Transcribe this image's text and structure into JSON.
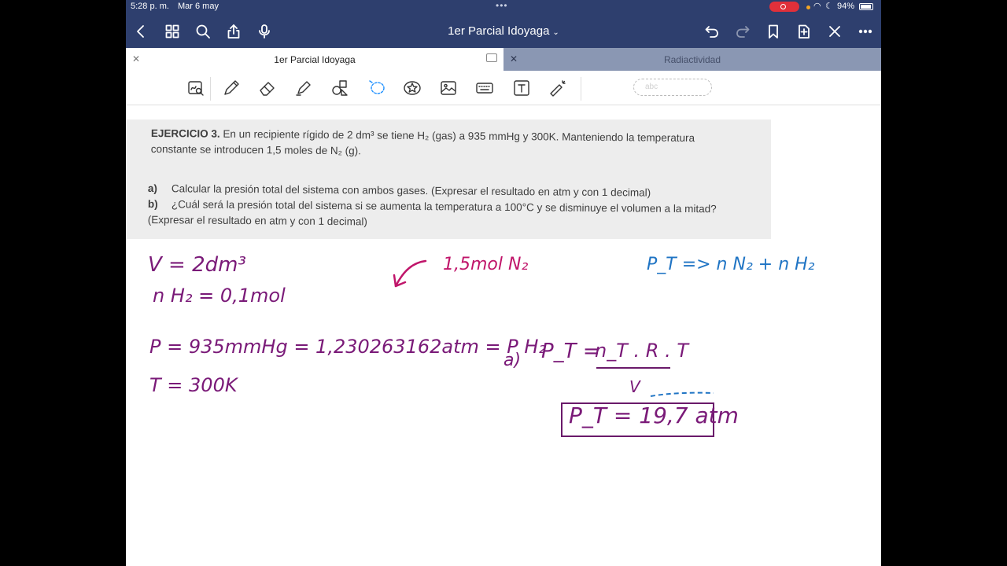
{
  "status_bar": {
    "time": "5:28 p. m.",
    "date": "Mar 6 may",
    "battery": "94%"
  },
  "nav": {
    "title": "1er Parcial Idoyaga"
  },
  "tabs": [
    {
      "label": "1er Parcial Idoyaga",
      "active": true
    },
    {
      "label": "Radiactividad",
      "active": false
    }
  ],
  "toolbar": {
    "tools": [
      "lasso-search",
      "pen",
      "eraser",
      "highlighter",
      "shapes",
      "lasso",
      "sticker",
      "image",
      "keyboard",
      "text",
      "laser-pointer"
    ],
    "handwriting_placeholder": "abc"
  },
  "exercise": {
    "title": "EJERCICIO 3.",
    "statement": "En un recipiente rígido de 2 dm³ se tiene H₂ (gas) a 935 mmHg y 300K. Manteniendo la temperatura constante se introducen 1,5 moles de N₂ (g).",
    "items": [
      {
        "key": "a)",
        "text": "Calcular la presión total del sistema con ambos gases. (Expresar el resultado en atm y con 1 decimal)"
      },
      {
        "key": "b)",
        "text": "¿Cuál será la presión total del sistema si se aumenta la temperatura a 100°C y se disminuye el volumen a la mitad? (Expresar el resultado en atm y con 1 decimal)"
      }
    ]
  },
  "notes": {
    "volume": "V = 2dm³",
    "moles_h2": "n H₂ = 0,1mol",
    "pressure": "P = 935mmHg = 1,230263162atm = P H₂",
    "temperature": "T = 300K",
    "moles_n2": "1,5mol N₂",
    "total_pressure_def": "P_T => n N₂ + n H₂",
    "formula_label": "a)",
    "formula_lhs": "P_T =",
    "formula_numerator": "n_T . R . T",
    "formula_denominator": "V",
    "result": "P_T = 19,7 atm"
  },
  "colors": {
    "nav_bar": "#2e3f6e",
    "ink_purple": "#7a1a78",
    "ink_magenta": "#c0156a",
    "ink_blue": "#1f74c4"
  }
}
